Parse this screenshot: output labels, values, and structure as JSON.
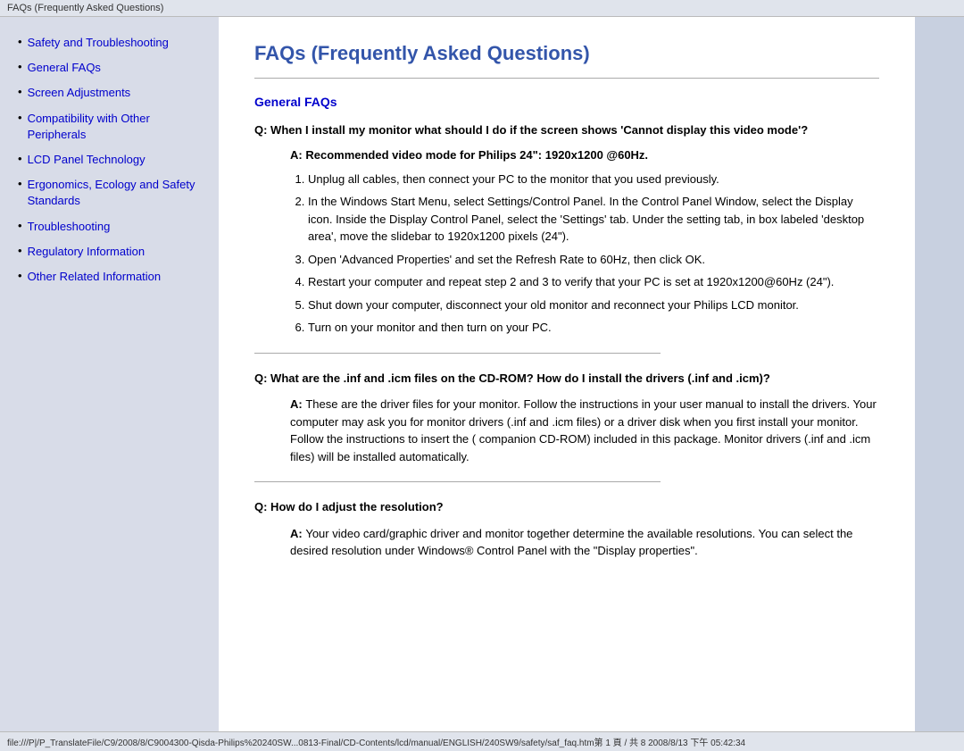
{
  "titleBar": {
    "text": "FAQs (Frequently Asked Questions)"
  },
  "sidebar": {
    "items": [
      {
        "label": "Safety and Troubleshooting",
        "href": "#"
      },
      {
        "label": "General FAQs",
        "href": "#"
      },
      {
        "label": "Screen Adjustments",
        "href": "#"
      },
      {
        "label": "Compatibility with Other Peripherals",
        "href": "#"
      },
      {
        "label": "LCD Panel Technology",
        "href": "#"
      },
      {
        "label": "Ergonomics, Ecology and Safety Standards",
        "href": "#"
      },
      {
        "label": "Troubleshooting",
        "href": "#"
      },
      {
        "label": "Regulatory Information",
        "href": "#"
      },
      {
        "label": "Other Related Information",
        "href": "#"
      }
    ]
  },
  "main": {
    "pageTitle": "FAQs (Frequently Asked Questions)",
    "sectionTitle": "General FAQs",
    "q1": {
      "question": "Q: When I install my monitor what should I do if the screen shows 'Cannot display this video mode'?",
      "answerLabel": "A:",
      "answerHighlight": "Recommended video mode for Philips 24\": 1920x1200 @60Hz.",
      "steps": [
        "Unplug all cables, then connect your PC to the monitor that you used previously.",
        "In the Windows Start Menu, select Settings/Control Panel. In the Control Panel Window, select the Display icon. Inside the Display Control Panel, select the 'Settings' tab. Under the setting tab, in box labeled 'desktop area', move the slidebar to 1920x1200 pixels (24\").",
        "Open 'Advanced Properties' and set the Refresh Rate to 60Hz, then click OK.",
        "Restart your computer and repeat step 2 and 3 to verify that your PC is set at 1920x1200@60Hz (24\").",
        "Shut down your computer, disconnect your old monitor and reconnect your Philips LCD monitor.",
        "Turn on your monitor and then turn on your PC."
      ]
    },
    "q2": {
      "question": "Q: What are the .inf and .icm files on the CD-ROM? How do I install the drivers (.inf and .icm)?",
      "answerLabel": "A:",
      "answerBody": "These are the driver files for your monitor. Follow the instructions in your user manual to install the drivers. Your computer may ask you for monitor drivers (.inf and .icm files) or a driver disk when you first install your monitor. Follow the instructions to insert the ( companion CD-ROM) included in this package. Monitor drivers (.inf and .icm files) will be installed automatically."
    },
    "q3": {
      "question": "Q: How do I adjust the resolution?",
      "answerLabel": "A:",
      "answerBody": "Your video card/graphic driver and monitor together determine the available resolutions. You can select the desired resolution under Windows® Control Panel with the \"Display properties\"."
    }
  },
  "statusBar": {
    "text": "file:///P|/P_TranslateFile/C9/2008/8/C9004300-Qisda-Philips%20240SW...0813-Final/CD-Contents/lcd/manual/ENGLISH/240SW9/safety/saf_faq.htm第 1 頁 / 共 8 2008/8/13 下午 05:42:34"
  }
}
